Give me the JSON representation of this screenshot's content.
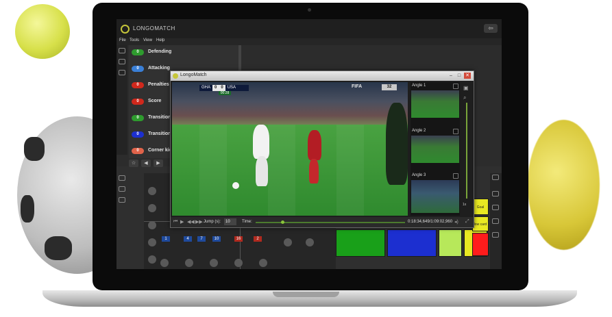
{
  "app": {
    "title": "LONGOMATCH",
    "back_icon": "arrow-left-icon"
  },
  "menu": [
    "File",
    "Tools",
    "View",
    "Help"
  ],
  "categories": [
    {
      "num": "0",
      "label": "Defending",
      "color": "#2e9b2e"
    },
    {
      "num": "0",
      "label": "Attacking",
      "color": "#3a7fd6"
    },
    {
      "num": "0",
      "label": "Penalties",
      "color": "#d0281c"
    },
    {
      "num": "0",
      "label": "Score",
      "color": "#d0281c"
    },
    {
      "num": "0",
      "label": "Transition",
      "color": "#2e9b2e"
    },
    {
      "num": "0",
      "label": "Transition",
      "color": "#1c2fd0"
    },
    {
      "num": "0",
      "label": "Corner kic",
      "color": "#e0634a"
    }
  ],
  "player_window": {
    "title": "LongoMatch",
    "jump_label": "Jump (s):",
    "jump_value": "10",
    "time_label": "Time:",
    "time_readout": "0:18:34,649/1:09:02,960",
    "zoom_label": "1x"
  },
  "broadcast": {
    "team_home": "GHA",
    "score_home": "0",
    "score_away": "0",
    "team_away": "USA",
    "match_clock": "00:28",
    "fifa": "FIFA",
    "clock": "32"
  },
  "angles": [
    {
      "label": "Angle 1"
    },
    {
      "label": "Angle 2"
    },
    {
      "label": "Angle 3"
    }
  ],
  "field_numbers": [
    "1",
    "4",
    "7",
    "10",
    "16",
    "2"
  ],
  "code_buttons": [
    {
      "text": "",
      "color": "#2fa52f"
    },
    {
      "text": "",
      "color": "#3ba3e6"
    },
    {
      "text": "",
      "color": "#b9e05a"
    },
    {
      "text": "",
      "color": "#e84a3a"
    },
    {
      "text": "",
      "color": "#19a019"
    },
    {
      "text": "",
      "color": "#1c2fd0"
    },
    {
      "text": "",
      "color": "#b7e85a"
    },
    {
      "text": "",
      "color": "#e8e822"
    },
    {
      "text": "",
      "color": "#ff1c1c"
    }
  ],
  "side_labels": [
    "Goal",
    "low card"
  ]
}
